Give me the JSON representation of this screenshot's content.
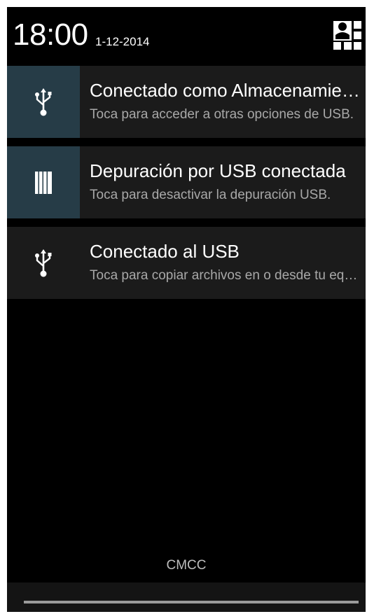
{
  "status": {
    "time": "18:00",
    "date": "1-12-2014",
    "settings_icon": "quick-settings-icon"
  },
  "notifications": [
    {
      "icon": "usb-icon",
      "title": "Conectado como Almacenamiento masivo",
      "text": "Toca para acceder a otras opciones de USB."
    },
    {
      "icon": "debug-icon",
      "title": "Depuración por USB conectada",
      "text": "Toca para desactivar la depuración USB."
    },
    {
      "icon": "usb-icon",
      "title": "Conectado al USB",
      "text": "Toca para copiar archivos en o desde tu equipo."
    }
  ],
  "carrier": "CMCC",
  "colors": {
    "background": "#000000",
    "notification_bg": "#1b1b1b",
    "icon_highlight_bg": "#263c47",
    "title_text": "#ffffff",
    "body_text": "#a8a8a8"
  }
}
